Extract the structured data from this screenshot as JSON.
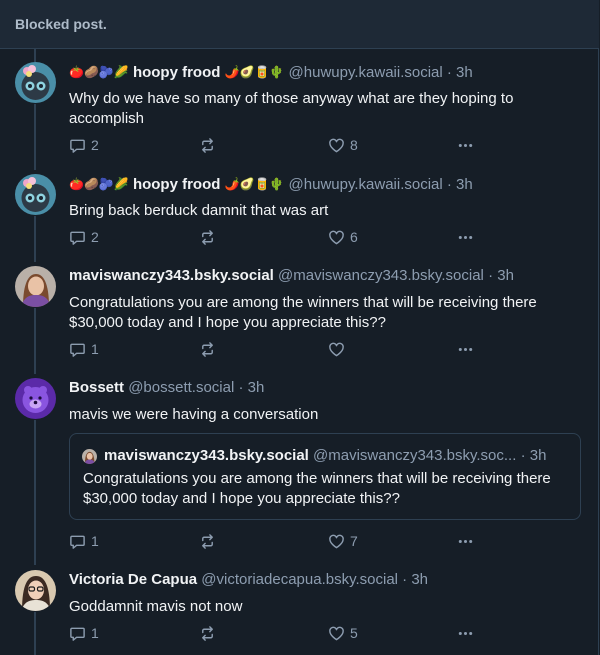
{
  "blocked": {
    "label": "Blocked post."
  },
  "posts": [
    {
      "emojis_before": "🍅🥔🫐🌽",
      "display_name": "hoopy frood",
      "emojis_after": "🌶️🥑🥫🌵",
      "handle": "@huwupy.kawaii.social",
      "time": "· 3h",
      "text": "Why do we have so many of those anyway what are they hoping to accomplish",
      "replies": "2",
      "reposts": "",
      "likes": "8"
    },
    {
      "emojis_before": "🍅🥔🫐🌽",
      "display_name": "hoopy frood",
      "emojis_after": "🌶️🥑🥫🌵",
      "handle": "@huwupy.kawaii.social",
      "time": "· 3h",
      "text": "Bring back berduck damnit that was art",
      "replies": "2",
      "reposts": "",
      "likes": "6"
    },
    {
      "display_name": "maviswanczy343.bsky.social",
      "handle": "@maviswanczy343.bsky.social",
      "time": "· 3h",
      "text": "Congratulations you are among the winners that will be receiving there $30,000 today and I hope you appreciate this??",
      "replies": "1",
      "reposts": "",
      "likes": ""
    },
    {
      "display_name": "Bossett",
      "handle": "@bossett.social",
      "time": "· 3h",
      "text": "mavis we were having a conversation",
      "quote": {
        "display_name": "maviswanczy343.bsky.social",
        "handle": "@maviswanczy343.bsky.soc...",
        "time": "· 3h",
        "text": "Congratulations you are among the winners that will be receiving there $30,000 today and I hope you appreciate this??"
      },
      "replies": "1",
      "reposts": "",
      "likes": "7"
    },
    {
      "display_name": "Victoria De Capua",
      "handle": "@victoriadecapua.bsky.social",
      "time": "· 3h",
      "text": "Goddamnit mavis not now",
      "replies": "1",
      "reposts": "",
      "likes": "5"
    }
  ],
  "icons": {
    "reply": "speech-bubble-icon",
    "repost": "repost-arrows-icon",
    "like": "heart-icon",
    "more": "ellipsis-icon"
  },
  "colors": {
    "background": "#161e27",
    "blocked_bar": "#1e2936",
    "border": "#2e4052",
    "muted_text": "#8d9db0",
    "text": "#f1f3f5"
  }
}
